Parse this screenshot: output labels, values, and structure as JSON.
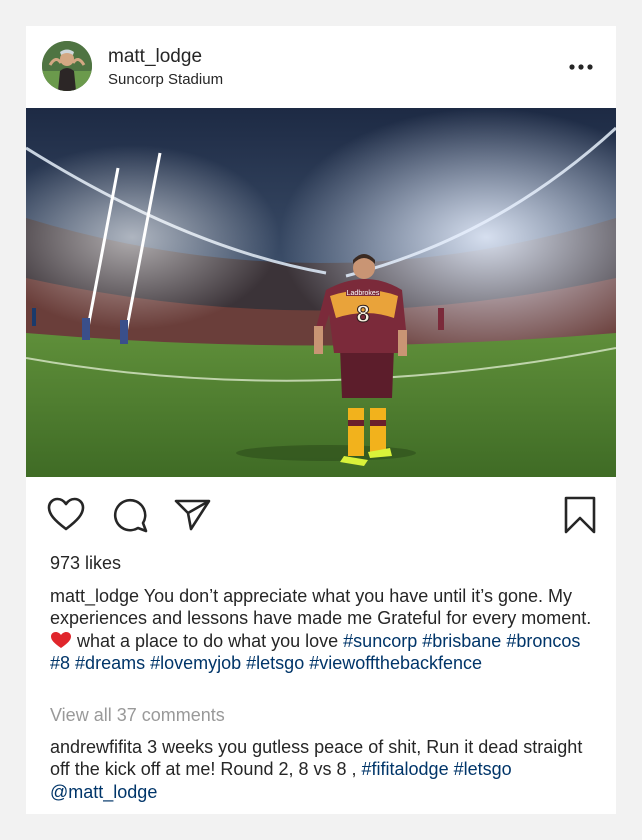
{
  "post": {
    "username": "matt_lodge",
    "location": "Suncorp Stadium",
    "likes": "973 likes",
    "caption": {
      "text1": " You don’t appreciate what you have until it’s gone. My experiences and lessons have made me Grateful for every moment. ",
      "text2": " what a place to do what you love ",
      "hashtags": [
        "#suncorp",
        "#brisbane",
        "#broncos",
        "#8",
        "#dreams",
        "#lovemyjob",
        "#letsgo",
        "#viewofftheback­fence"
      ]
    },
    "view_all_comments": "View all 37 comments",
    "comment": {
      "username": "andrewfifita",
      "text": " 3 weeks you gutless peace of shit, Run it dead straight off the kick off at me! Round 2, 8 vs 8 , ",
      "hashtag1": "#fifitalodge",
      "hashtag2": "#letsgo",
      "mention": "@matt_lodge"
    }
  },
  "photo": {
    "jersey_number": "8",
    "sponsor": "Ladbrokes"
  },
  "icons": {
    "more": "more-options-icon",
    "like": "heart-icon",
    "comment": "comment-bubble-icon",
    "share": "paper-plane-icon",
    "save": "bookmark-icon",
    "emoji": "red-heart-emoji"
  },
  "colors": {
    "hashtag": "#003569",
    "muted": "#999999",
    "text": "#262626"
  }
}
